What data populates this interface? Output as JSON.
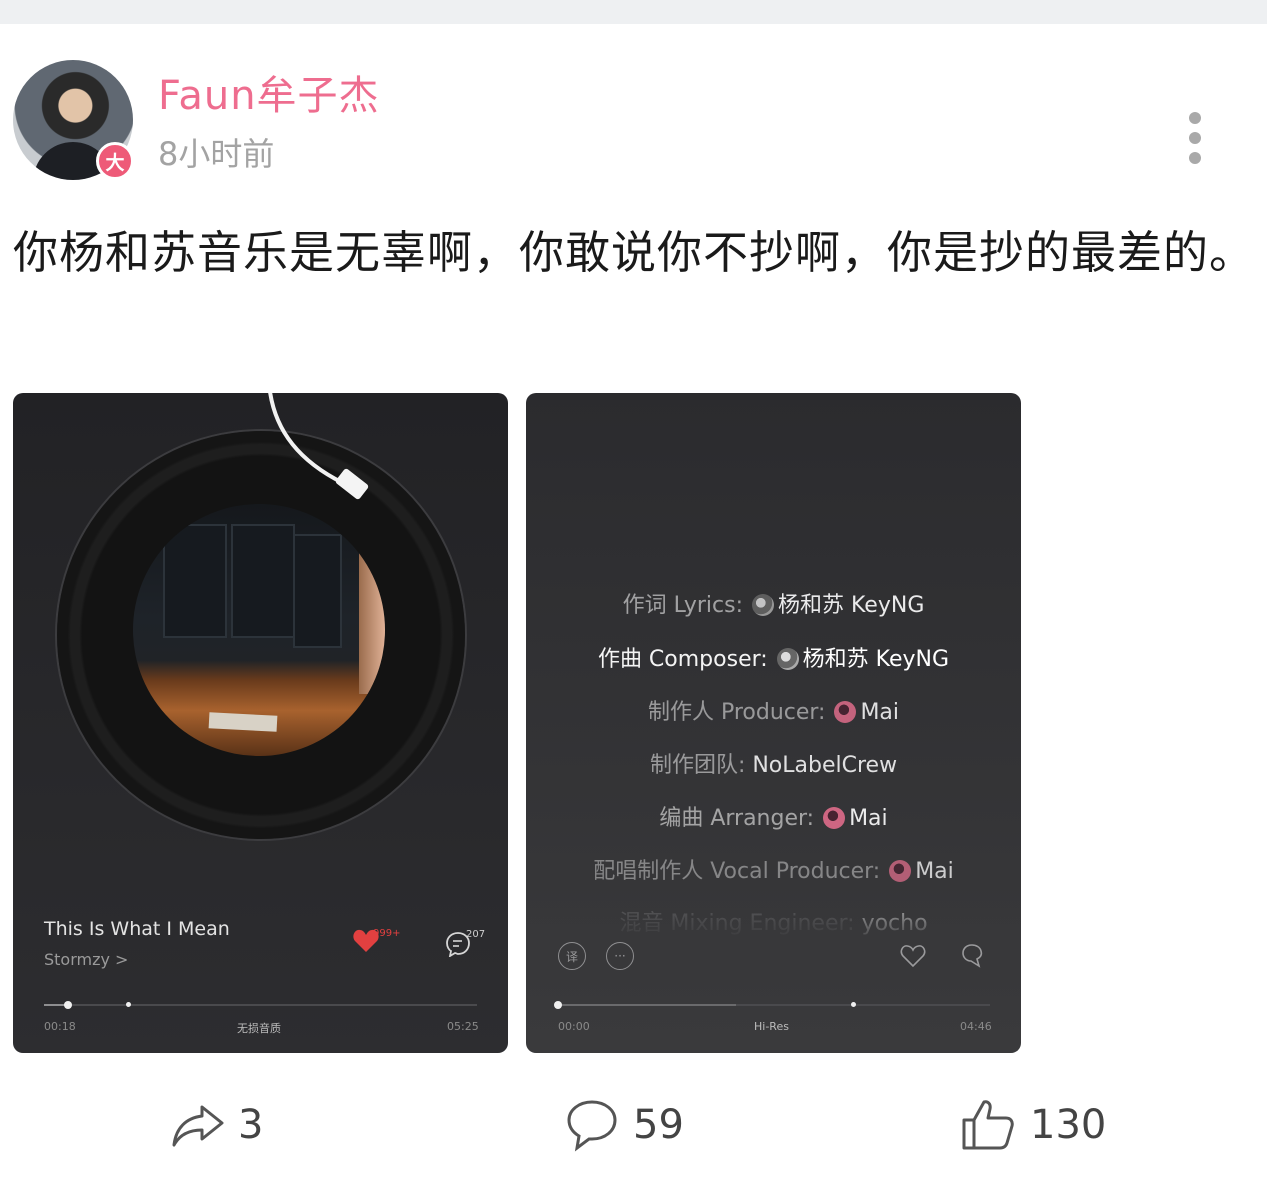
{
  "post": {
    "username": "Faun牟子杰",
    "timestamp": "8小时前",
    "badge": "大",
    "text": "你杨和苏音乐是无辜啊，你敢说你不抄啊，你是抄的最差的。"
  },
  "player1": {
    "song_title": "This Is What I Mean",
    "artist": "Stormzy >",
    "like_count": "999+",
    "comment_count": "207",
    "time_current": "00:18",
    "quality": "无损音质",
    "time_total": "05:25",
    "progress": 0.056
  },
  "player2": {
    "credits": [
      {
        "label": "作词 Lyrics: ",
        "value": "杨和苏 KeyNG",
        "avatar": "gray"
      },
      {
        "label": "作曲 Composer: ",
        "value": "杨和苏 KeyNG",
        "avatar": "gray"
      },
      {
        "label": "制作人 Producer: ",
        "value": "Mai",
        "avatar": "pink"
      },
      {
        "label": "制作团队: ",
        "value": "NoLabelCrew",
        "avatar": ""
      },
      {
        "label": "编曲 Arranger: ",
        "value": "Mai",
        "avatar": "pink"
      },
      {
        "label": "配唱制作人 Vocal Producer: ",
        "value": "Mai",
        "avatar": "pink"
      },
      {
        "label": "混音 Mixing Engineer: ",
        "value": "yocho",
        "avatar": ""
      }
    ],
    "translate_icon": "译",
    "more_icon": "···",
    "time_current": "00:00",
    "quality": "Hi-Res",
    "time_total": "04:46",
    "progress": 0.0
  },
  "actions": {
    "share_count": "3",
    "comment_count": "59",
    "like_count": "130"
  },
  "colors": {
    "username": "#ee6d8f",
    "badge": "#ee5a78",
    "like_heart": "#e24040"
  }
}
